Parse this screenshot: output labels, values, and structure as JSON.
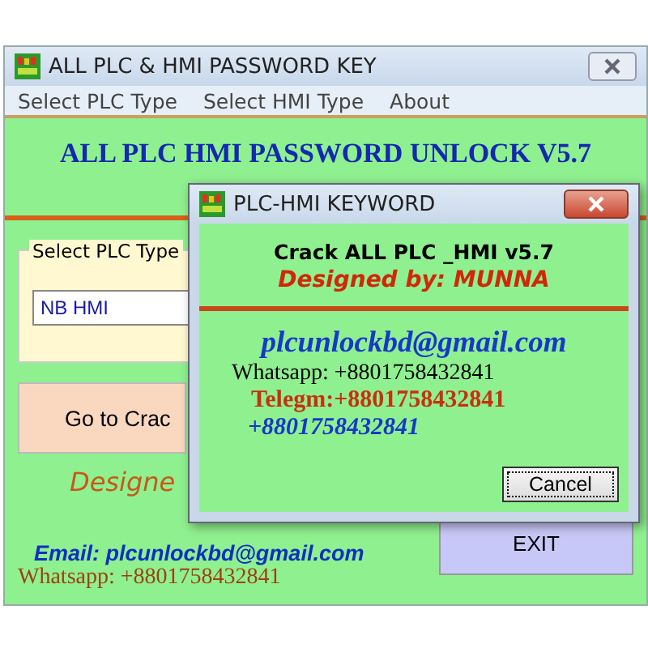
{
  "window": {
    "title": "ALL PLC & HMI PASSWORD KEY"
  },
  "menu": [
    "Select PLC Type",
    "Select HMI Type",
    "About"
  ],
  "heading": "ALL PLC HMI PASSWORD UNLOCK V5.7",
  "plc_group": {
    "label": "Select PLC Type",
    "value": "NB HMI"
  },
  "go_button": "Go to Crac",
  "designed": "Designe",
  "email": "Email: plcunlockbd@gmail.com",
  "whatsapp": "Whatsapp: +8801758432841",
  "exit_button": "EXIT",
  "dialog": {
    "title": "PLC-HMI KEYWORD",
    "line_1": "Crack ALL PLC _HMI  v5.7",
    "line_2": "Designed by: MUNNA",
    "email": "plcunlockbd@gmail.com",
    "whatsapp": "Whatsapp: +8801758432841",
    "telegram": "Telegm:+8801758432841",
    "phone": "+8801758432841",
    "cancel": "Cancel"
  }
}
